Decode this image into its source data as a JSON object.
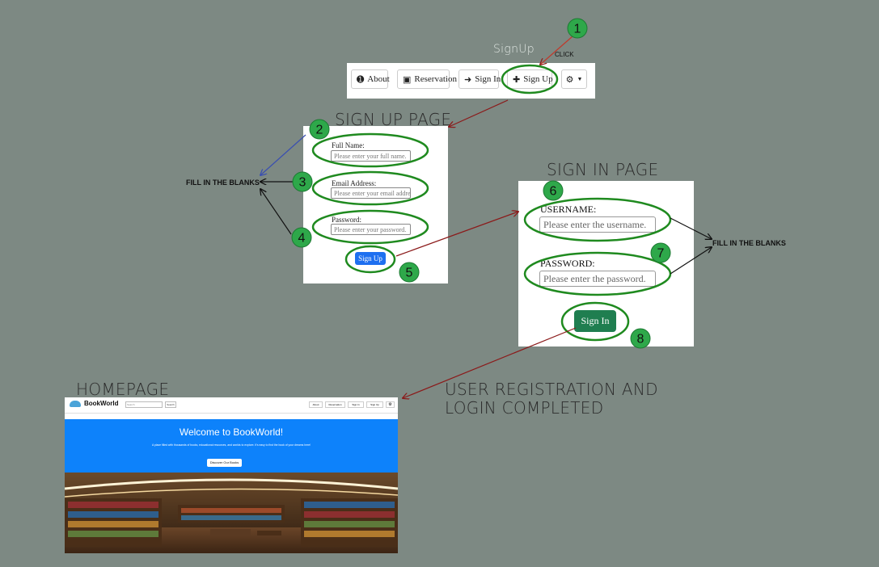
{
  "headings": {
    "signup_nav": "SignUp",
    "click": "CLICK",
    "signup_page": "SIGN UP PAGE",
    "signin_page": "SIGN IN PAGE",
    "homepage": "HOMEPAGE",
    "completed_line1": "USER REGISTRATION AND",
    "completed_line2": "LOGIN COMPLETED",
    "fill_left": "FILL IN THE BLANKS",
    "fill_right": "FILL IN THE BLANKS"
  },
  "steps": [
    "1",
    "2",
    "3",
    "4",
    "5",
    "6",
    "7",
    "8"
  ],
  "navbar": {
    "about": "About",
    "reservation": "Reservation",
    "signin": "Sign In",
    "signup": "Sign Up"
  },
  "signup_form": {
    "fullname_label": "Full Name:",
    "fullname_placeholder": "Please enter your full name.",
    "email_label": "Email Address:",
    "email_placeholder": "Please enter your email addres",
    "password_label": "Password:",
    "password_placeholder": "Please enter your password.",
    "submit": "Sign Up"
  },
  "signin_form": {
    "username_label": "USERNAME:",
    "username_placeholder": "Please enter the username.",
    "password_label": "PASSWORD:",
    "password_placeholder": "Please enter the password.",
    "submit": "Sign In"
  },
  "homepage": {
    "brand": "BookWorld",
    "search_placeholder": "Search",
    "search_button": "Search",
    "nav": [
      "About",
      "Reservation",
      "Sign In",
      "Sign Up"
    ],
    "hero_title": "Welcome to BookWorld!",
    "hero_text": "A place filled with thousands of books, educational resources, and worlds to explore. It's easy to find the book of your dreams here!",
    "hero_button": "Discover Our Books"
  },
  "colors": {
    "background": "#7d8983",
    "step_badge": "#2ea84a",
    "highlight_ring": "#1f8a1f",
    "arrow_red": "#8b1a1a",
    "hero_blue": "#0d82fb",
    "signin_green": "#1f7e50",
    "signup_blue": "#1e6ff0"
  }
}
